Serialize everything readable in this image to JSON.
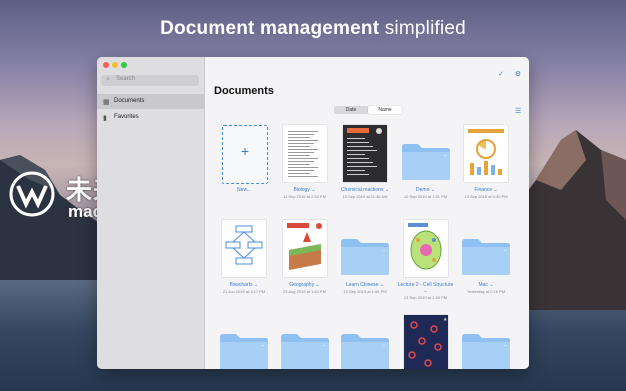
{
  "headline": {
    "bold": "Document management",
    "regular": "simplified"
  },
  "watermark": {
    "brand": "未来软件园",
    "url": "mac.orsoon.com"
  },
  "window": {
    "search_placeholder": "Search",
    "sidebar": [
      {
        "label": "Documents",
        "icon": "grid-icon"
      },
      {
        "label": "Favorites",
        "icon": "bookmark-icon"
      }
    ],
    "title": "Documents",
    "sort": {
      "options": [
        "Date",
        "Name"
      ],
      "selected": "Name"
    },
    "items": [
      {
        "name": "New...",
        "date": "",
        "kind": "new"
      },
      {
        "name": "Biology ⌄",
        "date": "11 Sep 2019 at 2:33 PM",
        "kind": "doc-text"
      },
      {
        "name": "Chemical reactions ⌄",
        "date": "13 Sep 2019 at 11:46 AM",
        "kind": "doc-dark"
      },
      {
        "name": "Demo ⌄",
        "date": "10 Sep 2019 at 1:51 PM",
        "kind": "folder"
      },
      {
        "name": "Finance ⌄",
        "date": "13 Sep 2019 at 5:40 PM",
        "kind": "doc-chart"
      },
      {
        "name": "flowcharts ⌄",
        "date": "21 Jun 2019 at 4:17 PM",
        "kind": "doc-flow"
      },
      {
        "name": "Geography ⌄",
        "date": "23 Aug 2019 at 1:40 PM",
        "kind": "doc-geo"
      },
      {
        "name": "Learn Chinese ⌄",
        "date": "13 Sep 2019 at 1:59 PM",
        "kind": "folder"
      },
      {
        "name": "Lecture 2 - Cell Structure ⌄",
        "date": "13 Sep 2019 at 1:59 PM",
        "kind": "doc-cell"
      },
      {
        "name": "Mac ⌄",
        "date": "Yesterday at 2:16 PM",
        "kind": "folder"
      },
      {
        "name": "",
        "date": "",
        "kind": "folder"
      },
      {
        "name": "",
        "date": "",
        "kind": "folder"
      },
      {
        "name": "",
        "date": "",
        "kind": "folder"
      },
      {
        "name": "",
        "date": "",
        "kind": "doc-pattern"
      },
      {
        "name": "",
        "date": "",
        "kind": "folder"
      }
    ]
  }
}
